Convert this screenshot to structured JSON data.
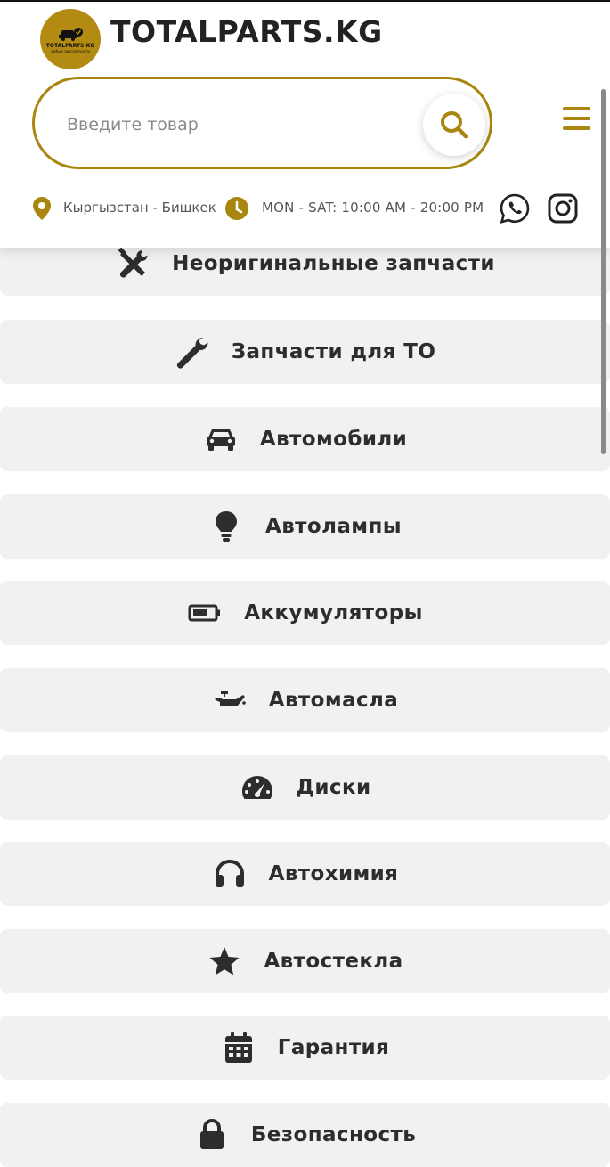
{
  "header": {
    "logo_text": "TOTALPARTS.KG",
    "logo_subtext": "любые автозапчасти",
    "title": "TOTALPARTS.KG",
    "accent_color": "#a8860f"
  },
  "search": {
    "placeholder": "Введите товар"
  },
  "info": {
    "location": "Кыргызстан - Бишкек",
    "hours": "MON - SAT: 10:00 AM - 20:00 PM"
  },
  "categories": [
    {
      "label": "Неоригинальные запчасти",
      "icon": "tools-icon"
    },
    {
      "label": "Запчасти для ТО",
      "icon": "wrench-icon"
    },
    {
      "label": "Автомобили",
      "icon": "car-icon"
    },
    {
      "label": "Автолампы",
      "icon": "lightbulb-icon"
    },
    {
      "label": "Аккумуляторы",
      "icon": "battery-icon"
    },
    {
      "label": "Автомасла",
      "icon": "oil-can-icon"
    },
    {
      "label": "Диски",
      "icon": "speedometer-icon"
    },
    {
      "label": "Автохимия",
      "icon": "headphones-icon"
    },
    {
      "label": "Автостекла",
      "icon": "star-icon"
    },
    {
      "label": "Гарантия",
      "icon": "calendar-icon"
    },
    {
      "label": "Безопасность",
      "icon": "lock-icon"
    }
  ]
}
